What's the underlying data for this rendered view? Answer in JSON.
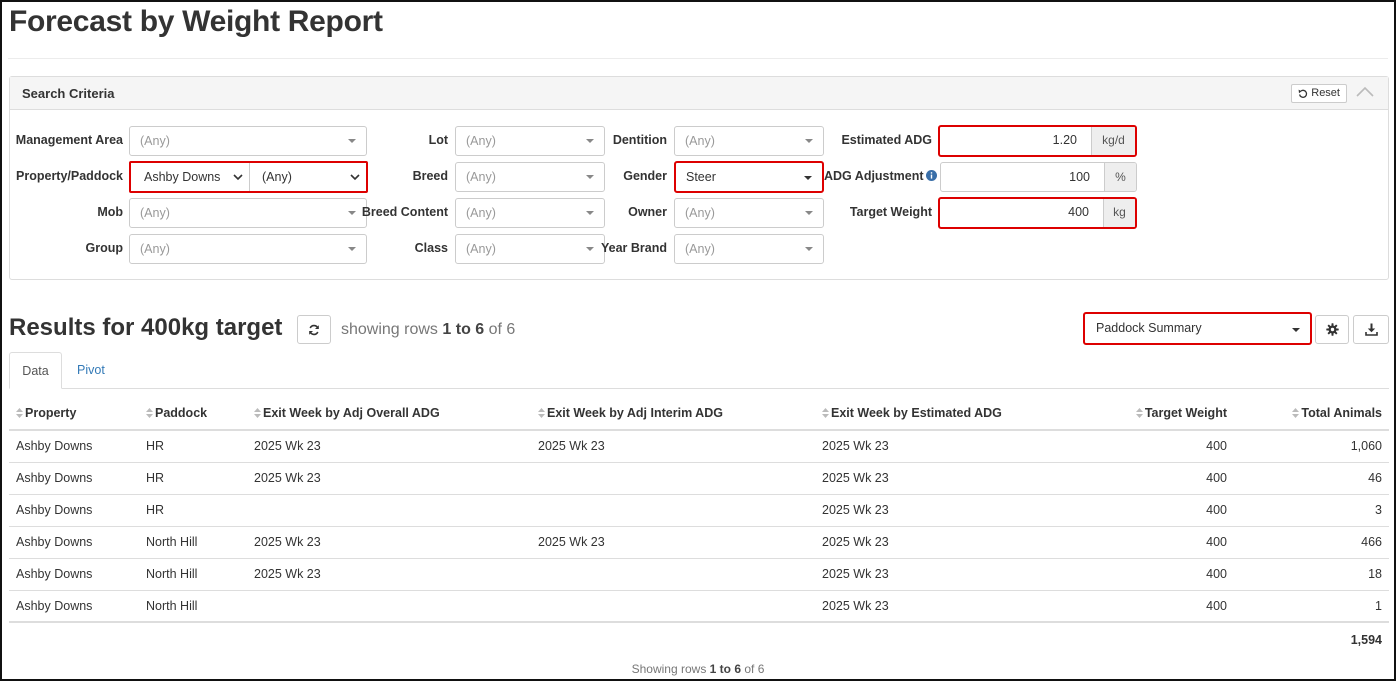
{
  "page": {
    "title": "Forecast by Weight Report"
  },
  "search": {
    "title": "Search Criteria",
    "reset_label": "Reset",
    "fields": {
      "management_area": {
        "label": "Management Area",
        "value": "(Any)"
      },
      "property_paddock": {
        "label": "Property/Paddock",
        "property_value": "Ashby Downs",
        "paddock_value": "(Any)"
      },
      "mob": {
        "label": "Mob",
        "value": "(Any)"
      },
      "group": {
        "label": "Group",
        "value": "(Any)"
      },
      "lot": {
        "label": "Lot",
        "value": "(Any)"
      },
      "breed": {
        "label": "Breed",
        "value": "(Any)"
      },
      "breed_content": {
        "label": "Breed Content",
        "value": "(Any)"
      },
      "class": {
        "label": "Class",
        "value": "(Any)"
      },
      "dentition": {
        "label": "Dentition",
        "value": "(Any)"
      },
      "gender": {
        "label": "Gender",
        "value": "Steer"
      },
      "owner": {
        "label": "Owner",
        "value": "(Any)"
      },
      "year_brand": {
        "label": "Year Brand",
        "value": "(Any)"
      },
      "estimated_adg": {
        "label": "Estimated ADG",
        "value": "1.20",
        "unit": "kg/d"
      },
      "adg_adjustment": {
        "label": "ADG Adjustment",
        "value": "100",
        "unit": "%"
      },
      "target_weight": {
        "label": "Target Weight",
        "value": "400",
        "unit": "kg"
      }
    }
  },
  "results": {
    "title": "Results for 400kg target",
    "showing_prefix": "showing rows",
    "range": "1 to 6",
    "of_text": "of 6",
    "summary_selected": "Paddock Summary",
    "tabs": [
      {
        "label": "Data"
      },
      {
        "label": "Pivot"
      }
    ],
    "columns": [
      "Property",
      "Paddock",
      "Exit Week by Adj Overall ADG",
      "Exit Week by Adj Interim ADG",
      "Exit Week by Estimated ADG",
      "Target Weight",
      "Total Animals"
    ],
    "rows": [
      [
        "Ashby Downs",
        "HR",
        "2025 Wk 23",
        "2025 Wk 23",
        "2025 Wk 23",
        "400",
        "1,060"
      ],
      [
        "Ashby Downs",
        "HR",
        "2025 Wk 23",
        "",
        "2025 Wk 23",
        "400",
        "46"
      ],
      [
        "Ashby Downs",
        "HR",
        "",
        "",
        "2025 Wk 23",
        "400",
        "3"
      ],
      [
        "Ashby Downs",
        "North Hill",
        "2025 Wk 23",
        "2025 Wk 23",
        "2025 Wk 23",
        "400",
        "466"
      ],
      [
        "Ashby Downs",
        "North Hill",
        "2025 Wk 23",
        "",
        "2025 Wk 23",
        "400",
        "18"
      ],
      [
        "Ashby Downs",
        "North Hill",
        "",
        "",
        "2025 Wk 23",
        "400",
        "1"
      ]
    ],
    "total": "1,594",
    "footer_prefix": "Showing rows",
    "footer_range": "1 to 6",
    "footer_of": "of 6"
  },
  "colors": {
    "highlight": "#dd0000",
    "link": "#337ab7"
  }
}
